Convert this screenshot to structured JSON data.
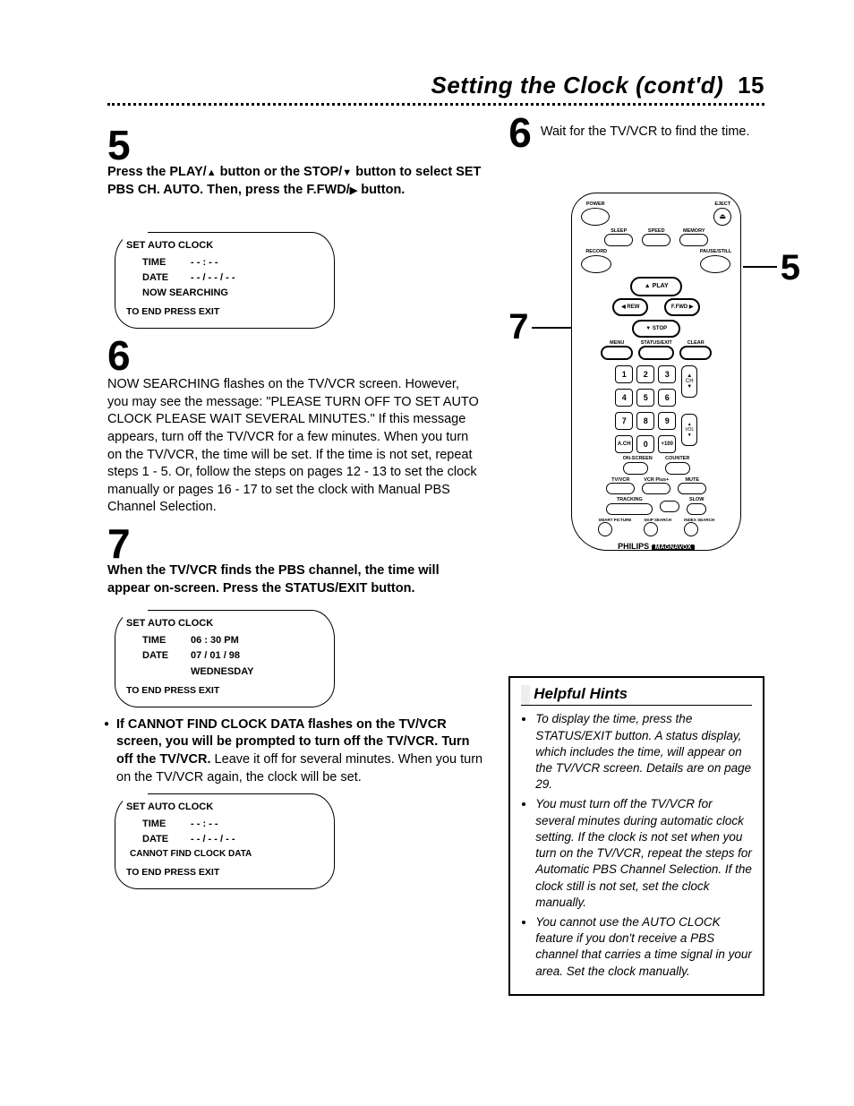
{
  "header": {
    "title": "Setting the Clock (cont'd)",
    "page_number": "15"
  },
  "left": {
    "step5": {
      "num": "5",
      "text_before_play": "Press the ",
      "play_label": "PLAY/",
      "text_mid1": " button or the ",
      "stop_label": "STOP/",
      "text_mid2": " button to select ",
      "set_pbs": "SET PBS CH. AUTO.",
      "then_press": " Then, press the ",
      "ffwd_label": "F.FWD/",
      "text_after": " button."
    },
    "osd1": {
      "title": "SET AUTO CLOCK",
      "time_label": "TIME",
      "time_value": "- - : - -",
      "date_label": "DATE",
      "date_value": "- - / - - / - -",
      "line3": "NOW SEARCHING",
      "foot": "TO END PRESS EXIT"
    },
    "step6": {
      "num": "6",
      "body": "NOW SEARCHING flashes on the TV/VCR screen. However, you may see the message: \"PLEASE TURN OFF TO SET AUTO CLOCK PLEASE WAIT SEVERAL MINUTES.\" If this message appears, turn off the TV/VCR for a few minutes. When you turn on the TV/VCR, the time will be set. If the time is not set, repeat steps 1 - 5. Or, follow the steps on pages 12 - 13 to set the clock manually or pages 16 - 17 to set the clock with Manual PBS Channel Selection."
    },
    "step7": {
      "num": "7",
      "bold": "When the TV/VCR finds the PBS channel, the time will appear on-screen. Press the STATUS/EXIT button."
    },
    "osd2": {
      "title": "SET AUTO CLOCK",
      "time_label": "TIME",
      "time_value": "06 : 30 PM",
      "date_label": "DATE",
      "date_value": "07 / 01 / 98",
      "day": "WEDNESDAY",
      "foot": "TO END PRESS EXIT"
    },
    "bullet": {
      "bold": "If CANNOT FIND CLOCK DATA flashes on the TV/VCR screen, you will be prompted to turn off the TV/VCR. Turn off the TV/VCR.",
      "rest": " Leave it off for several minutes. When you turn on the TV/VCR again, the clock will be set."
    },
    "osd3": {
      "title": "SET AUTO CLOCK",
      "time_label": "TIME",
      "time_value": "- - : - -",
      "date_label": "DATE",
      "date_value": "- - / - - / - -",
      "line3": "CANNOT FIND CLOCK DATA",
      "foot": "TO END PRESS EXIT"
    }
  },
  "right": {
    "step6": {
      "num": "6",
      "text": "Wait for the TV/VCR to find the time."
    },
    "callouts": {
      "five": "5",
      "seven": "7"
    },
    "remote": {
      "power": "POWER",
      "eject": "EJECT",
      "sleep": "SLEEP",
      "speed": "SPEED",
      "memory": "MEMORY",
      "record": "RECORD",
      "pause": "PAUSE/STILL",
      "play": "PLAY",
      "rew": "REW",
      "ffwd": "F.FWD",
      "stop": "STOP",
      "menu": "MENU",
      "statusexit": "STATUS/EXIT",
      "clear": "CLEAR",
      "ch": "CH",
      "ach": "A.CH",
      "plus100": "+100",
      "vol": "VOL",
      "onscreen": "ON-SCREEN",
      "counter": "COUNTER",
      "tvvcr": "TV/VCR",
      "vcrplus": "VCR Plus+",
      "mute": "MUTE",
      "tracking": "TRACKING",
      "slow": "SLOW",
      "smartpicture": "SMART PICTURE",
      "skip": "SKIP SEARCH",
      "index": "INDEX SEARCH",
      "brand": "PHILIPS",
      "brand2": "MAGNAVOX"
    }
  },
  "hints": {
    "title": "Helpful Hints",
    "items": [
      "To display the time, press the STATUS/EXIT button. A status display, which includes the time, will appear on the TV/VCR screen. Details are on page 29.",
      "You must turn off the TV/VCR for several minutes during automatic clock setting. If the clock is not set when you turn on the TV/VCR, repeat the steps for Automatic PBS Channel Selection. If the clock still is not set, set the clock manually.",
      "You cannot use the AUTO CLOCK feature if you don't receive a PBS channel that carries a time signal in your area. Set the clock manually."
    ]
  }
}
